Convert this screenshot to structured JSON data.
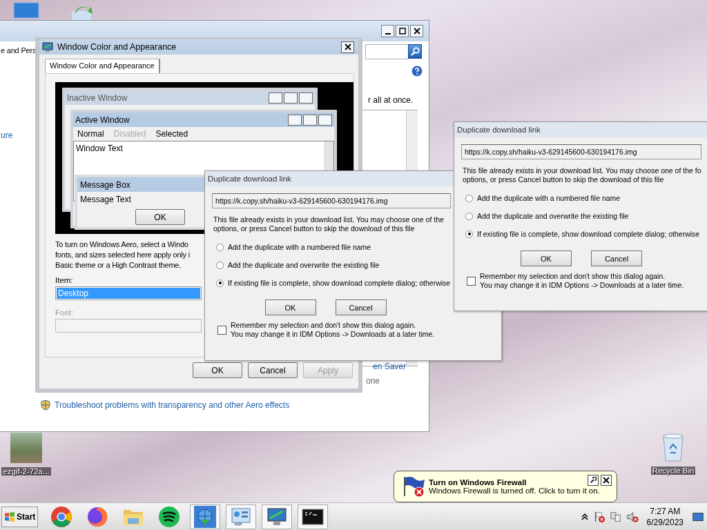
{
  "desktop_icons": [
    {
      "label": "ezgif-2-72a...",
      "kind": "photo"
    },
    {
      "label": "Recycle Bin",
      "kind": "recycle"
    }
  ],
  "control_panel": {
    "breadcrumb": "e and Pers",
    "sidebar_link": "ure",
    "description": "r all at once.",
    "screen_saver_link": "en Saver",
    "screen_saver_value": "one",
    "troubleshoot_link": "Troubleshoot problems with transparency and other Aero effects"
  },
  "appearance_dialog": {
    "title": "Window Color and Appearance",
    "tabs": [
      {
        "label": "Window Color and Appearance",
        "selected": true
      }
    ],
    "preview": {
      "inactive_title": "Inactive Window",
      "active_title": "Active Window",
      "menu": [
        {
          "label": "Normal",
          "kind": "normal"
        },
        {
          "label": "Disabled",
          "kind": "disabled"
        },
        {
          "label": "Selected",
          "kind": "selected"
        }
      ],
      "window_text": "Window Text",
      "message_box_title": "Message Box",
      "message_text": "Message Text",
      "ok": "OK"
    },
    "info_lines": [
      "To turn on Windows Aero, select a Windo",
      "fonts, and sizes selected here apply only i",
      "Basic theme or a High Contrast theme."
    ],
    "item_label": "Item:",
    "item_value": "Desktop",
    "font_label": "Font:",
    "font_disabled": true,
    "buttons": [
      {
        "label": "OK",
        "disabled": false
      },
      {
        "label": "Cancel",
        "disabled": false
      },
      {
        "label": "Apply",
        "disabled": true
      }
    ]
  },
  "download_dialogs": [
    {
      "title": "Duplicate download link",
      "url": "https://k.copy.sh/haiku-v3-629145600-630194176.img",
      "message_lines": [
        "This file already exists in your download list. You may choose one of the",
        "options, or press Cancel button to skip the download of this file"
      ],
      "options": [
        {
          "label": "Add the duplicate with a numbered file name",
          "selected": false
        },
        {
          "label": "Add the duplicate and overwrite the existing file",
          "selected": false
        },
        {
          "label": "If existing file is complete, show download complete dialog; otherwise",
          "selected": true
        }
      ],
      "buttons": [
        "OK",
        "Cancel"
      ],
      "remember": {
        "checked": false,
        "lines": [
          "Remember my selection and don't show this dialog again.",
          "You may change it in IDM Options -> Downloads at a later time."
        ]
      }
    },
    {
      "title": "Duplicate download link",
      "url": "https://k.copy.sh/haiku-v3-629145600-630194176.img",
      "message_lines": [
        "This file already exists in your download list. You may choose one of the fo",
        "options, or press Cancel button to skip the download of this file"
      ],
      "options": [
        {
          "label": "Add the duplicate with a numbered file name",
          "selected": false
        },
        {
          "label": "Add the duplicate and overwrite the existing file",
          "selected": false
        },
        {
          "label": "If existing file is complete, show download complete dialog; otherwise",
          "selected": true
        }
      ],
      "buttons": [
        "OK",
        "Cancel"
      ],
      "remember": {
        "checked": false,
        "lines": [
          "Remember my selection and don't show this dialog again.",
          "You may change it in IDM Options -> Downloads at a later time."
        ]
      }
    }
  ],
  "balloon": {
    "title": "Turn on Windows Firewall",
    "message": "Windows Firewall is turned off. Click to turn it on."
  },
  "taskbar": {
    "start": "Start",
    "apps": [
      {
        "kind": "chrome",
        "running": false
      },
      {
        "kind": "firefox",
        "running": false
      },
      {
        "kind": "folder",
        "running": false
      },
      {
        "kind": "spotify",
        "running": false
      },
      {
        "kind": "idm",
        "running": true
      },
      {
        "kind": "control",
        "running": true
      },
      {
        "kind": "display",
        "running": true
      },
      {
        "kind": "console",
        "running": true
      }
    ],
    "time": "7:27 AM",
    "date": "6/29/2023"
  }
}
